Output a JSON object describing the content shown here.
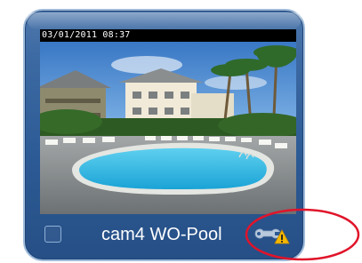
{
  "camera_tile": {
    "timestamp": "03/01/2011 08:37",
    "camera_name": "cam4 WO-Pool",
    "icons": {
      "settings": "wrench-icon",
      "status": "warning-icon"
    },
    "colors": {
      "tile_background": "#2c5a94",
      "tile_border": "#9fbbd9",
      "label_text": "#ffffff",
      "warning": "#f5b800",
      "highlight_ring": "#e0142a"
    }
  }
}
